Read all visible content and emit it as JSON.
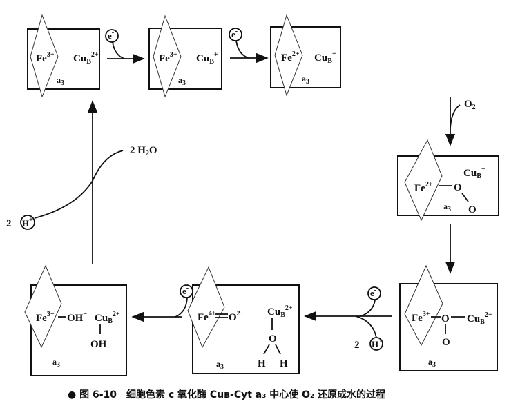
{
  "states": [
    {
      "fe": "Fe",
      "fe_charge": "3+",
      "cu": "Cu",
      "cu_sub": "B",
      "cu_charge": "2+",
      "heme": "a",
      "heme_sub": "3"
    },
    {
      "fe": "Fe",
      "fe_charge": "3+",
      "cu": "Cu",
      "cu_sub": "B",
      "cu_charge": "+",
      "heme": "a",
      "heme_sub": "3"
    },
    {
      "fe": "Fe",
      "fe_charge": "2+",
      "cu": "Cu",
      "cu_sub": "B",
      "cu_charge": "+",
      "heme": "a",
      "heme_sub": "3"
    },
    {
      "fe": "Fe",
      "fe_charge": "2+",
      "cu": "Cu",
      "cu_sub": "B",
      "cu_charge": "+",
      "o1": "O",
      "o2": "O",
      "heme": "a",
      "heme_sub": "3"
    },
    {
      "fe": "Fe",
      "fe_charge": "3+",
      "o1": "O",
      "o2": "O",
      "o2_charge": "-",
      "cu": "Cu",
      "cu_sub": "B",
      "cu_charge": "2+",
      "heme": "a",
      "heme_sub": "3"
    },
    {
      "fe": "Fe",
      "fe_charge": "4+",
      "oxo": "O",
      "oxo_charge": "2−",
      "cu": "Cu",
      "cu_sub": "B",
      "cu_charge": "2+",
      "o": "O",
      "h1": "H",
      "h2": "H",
      "heme": "a",
      "heme_sub": "3"
    },
    {
      "fe": "Fe",
      "fe_charge": "3+",
      "oh": "OH",
      "oh_charge": "−",
      "cu": "Cu",
      "cu_sub": "B",
      "cu_charge": "2+",
      "oh2": "OH",
      "heme": "a",
      "heme_sub": "3"
    }
  ],
  "reagents": {
    "electron": "e",
    "electron_charge": "-",
    "oxygen": "O",
    "oxygen_sub": "2",
    "proton_coef": "2",
    "proton": "H",
    "proton_charge": "+",
    "water": "2 H",
    "water_sub": "2",
    "water_o": "O"
  },
  "caption": "● 图 6-10　细胞色素 c 氧化酶 Cuʙ-Cyt a₃ 中心使 O₂ 还原成水的过程"
}
